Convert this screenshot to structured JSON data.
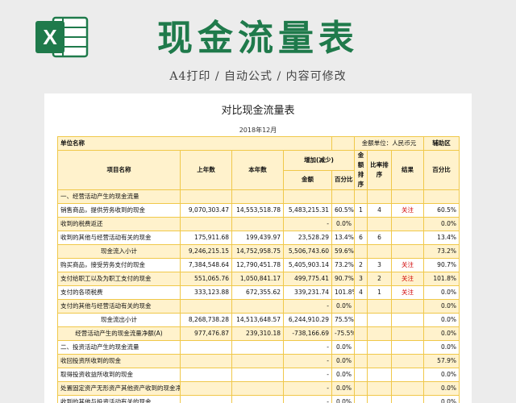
{
  "banner": {
    "title": "现金流量表",
    "subtitle": "A4打印 / 自动公式 / 内容可修改"
  },
  "doc": {
    "title": "对比现金流量表",
    "date": "2018年12月",
    "header": {
      "unit_name": "单位名称",
      "money_unit_label": "金额单位：",
      "money_unit_value": "人民币元",
      "aux_area": "辅助区",
      "item_name": "项目名称",
      "last_year": "上年数",
      "this_year": "本年数",
      "change": "增加(减少)",
      "amount": "金额",
      "percent": "百分比",
      "amount_rank": "金额排序",
      "ratio_rank": "比率排序",
      "result": "结果",
      "aux_percent": "百分比"
    },
    "rows": [
      {
        "name": "一、经营活动产生的现金流量",
        "last": "",
        "cur": "",
        "amt": "",
        "pct": "",
        "r1": "",
        "r2": "",
        "res": "",
        "aux": "",
        "style": "section"
      },
      {
        "name": "销售商品，提供劳务收到的现金",
        "last": "9,070,303.47",
        "cur": "14,553,518.78",
        "amt": "5,483,215.31",
        "pct": "60.5%",
        "r1": "1",
        "r2": "4",
        "res": "关注",
        "aux": "60.5%",
        "style": "item"
      },
      {
        "name": "收到的税费返还",
        "last": "",
        "cur": "",
        "amt": "-",
        "pct": "0.0%",
        "r1": "",
        "r2": "",
        "res": "",
        "aux": "0.0%",
        "style": "item-y"
      },
      {
        "name": "收到的其他与经营活动有关的现金",
        "last": "175,911.68",
        "cur": "199,439.97",
        "amt": "23,528.29",
        "pct": "13.4%",
        "r1": "6",
        "r2": "6",
        "res": "",
        "aux": "13.4%",
        "style": "item"
      },
      {
        "name": "现金流入小计",
        "last": "9,246,215.15",
        "cur": "14,752,958.75",
        "amt": "5,506,743.60",
        "pct": "59.6%",
        "r1": "",
        "r2": "",
        "res": "",
        "aux": "73.2%",
        "style": "sub"
      },
      {
        "name": "购买商品，接受劳务支付的现金",
        "last": "7,384,548.64",
        "cur": "12,790,451.78",
        "amt": "5,405,903.14",
        "pct": "73.2%",
        "r1": "2",
        "r2": "3",
        "res": "关注",
        "aux": "90.7%",
        "style": "item"
      },
      {
        "name": "支付给职工以及为职工支付的现金",
        "last": "551,065.76",
        "cur": "1,050,841.17",
        "amt": "499,775.41",
        "pct": "90.7%",
        "r1": "3",
        "r2": "2",
        "res": "关注",
        "aux": "101.8%",
        "style": "item-y"
      },
      {
        "name": "支付的各项税费",
        "last": "333,123.88",
        "cur": "672,355.62",
        "amt": "339,231.74",
        "pct": "101.8%",
        "r1": "4",
        "r2": "1",
        "res": "关注",
        "aux": "0.0%",
        "style": "item"
      },
      {
        "name": "支付的其他与经营活动有关的现金",
        "last": "",
        "cur": "",
        "amt": "-",
        "pct": "0.0%",
        "r1": "",
        "r2": "",
        "res": "",
        "aux": "0.0%",
        "style": "item-y"
      },
      {
        "name": "现金流出小计",
        "last": "8,268,738.28",
        "cur": "14,513,648.57",
        "amt": "6,244,910.29",
        "pct": "75.5%",
        "r1": "",
        "r2": "",
        "res": "",
        "aux": "0.0%",
        "style": "sub-w"
      },
      {
        "name": "经营活动产生的现金流量净额(A)",
        "last": "977,476.87",
        "cur": "239,310.18",
        "amt": "-738,166.69",
        "pct": "-75.5%",
        "r1": "",
        "r2": "",
        "res": "",
        "aux": "0.0%",
        "style": "sub"
      },
      {
        "name": "二、投资活动产生的现金流量",
        "last": "",
        "cur": "",
        "amt": "-",
        "pct": "0.0%",
        "r1": "",
        "r2": "",
        "res": "",
        "aux": "0.0%",
        "style": "section-w"
      },
      {
        "name": "收回投资所收到的现金",
        "last": "",
        "cur": "",
        "amt": "-",
        "pct": "0.0%",
        "r1": "",
        "r2": "",
        "res": "",
        "aux": "57.9%",
        "style": "item-y"
      },
      {
        "name": "取得投资收益所收到的现金",
        "last": "",
        "cur": "",
        "amt": "-",
        "pct": "0.0%",
        "r1": "",
        "r2": "",
        "res": "",
        "aux": "0.0%",
        "style": "item"
      },
      {
        "name": "处置固定资产无形资产其他资产收到的现金净额",
        "last": "",
        "cur": "",
        "amt": "-",
        "pct": "0.0%",
        "r1": "",
        "r2": "",
        "res": "",
        "aux": "0.0%",
        "style": "item-y"
      },
      {
        "name": "收到的其他与投资活动有关的现金",
        "last": "",
        "cur": "",
        "amt": "-",
        "pct": "0.0%",
        "r1": "",
        "r2": "",
        "res": "",
        "aux": "0.0%",
        "style": "item"
      }
    ]
  },
  "colors": {
    "brand_green": "#1f7a4b",
    "row_yellow": "#fff2cc",
    "border": "#f0c84a",
    "alert_red": "#d00000"
  },
  "icons": {
    "logo": "excel-icon"
  }
}
